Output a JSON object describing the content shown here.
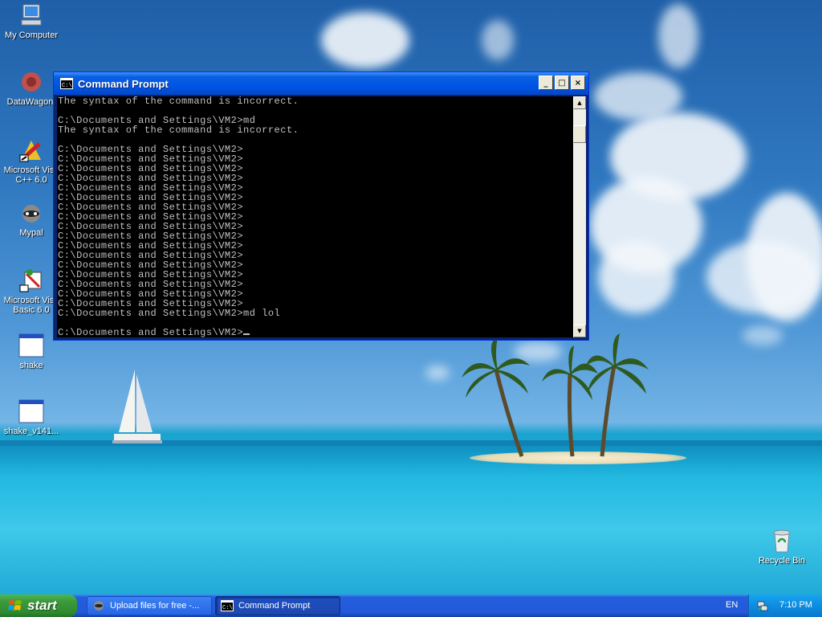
{
  "desktop": {
    "icons": [
      {
        "label": "My Computer",
        "icon": "my-computer-icon"
      },
      {
        "label": "DataWagon.",
        "icon": "datawagon-icon"
      },
      {
        "label": "Microsoft Visu C++ 6.0",
        "line1": "Microsoft Visu",
        "line2": "C++ 6.0",
        "icon": "visual-cpp-icon"
      },
      {
        "label": "Mypal",
        "icon": "mypal-icon"
      },
      {
        "label": "Microsoft Visu Basic 6.0",
        "line1": "Microsoft Visu",
        "line2": "Basic 6.0",
        "icon": "visual-basic-icon"
      },
      {
        "label": "shake",
        "icon": "application-window-icon"
      },
      {
        "label": "shake_v141...",
        "icon": "application-window-icon"
      },
      {
        "label": "Recycle Bin",
        "icon": "recycle-bin-icon"
      }
    ]
  },
  "window": {
    "title": "Command Prompt",
    "buttons": {
      "minimize": "_",
      "maximize": "□",
      "close": "×"
    },
    "console_lines": [
      "The syntax of the command is incorrect.",
      "",
      "C:\\Documents and Settings\\VM2>md",
      "The syntax of the command is incorrect.",
      "",
      "C:\\Documents and Settings\\VM2>",
      "C:\\Documents and Settings\\VM2>",
      "C:\\Documents and Settings\\VM2>",
      "C:\\Documents and Settings\\VM2>",
      "C:\\Documents and Settings\\VM2>",
      "C:\\Documents and Settings\\VM2>",
      "C:\\Documents and Settings\\VM2>",
      "C:\\Documents and Settings\\VM2>",
      "C:\\Documents and Settings\\VM2>",
      "C:\\Documents and Settings\\VM2>",
      "C:\\Documents and Settings\\VM2>",
      "C:\\Documents and Settings\\VM2>",
      "C:\\Documents and Settings\\VM2>",
      "C:\\Documents and Settings\\VM2>",
      "C:\\Documents and Settings\\VM2>",
      "C:\\Documents and Settings\\VM2>",
      "C:\\Documents and Settings\\VM2>",
      "C:\\Documents and Settings\\VM2>md lol",
      ""
    ],
    "prompt": "C:\\Documents and Settings\\VM2>"
  },
  "taskbar": {
    "start_label": "start",
    "tasks": [
      {
        "label": "Upload files for free -...",
        "icon": "browser-icon"
      },
      {
        "label": "Command Prompt",
        "icon": "command-prompt-icon"
      }
    ],
    "language": "EN",
    "clock": "7:10 PM"
  }
}
